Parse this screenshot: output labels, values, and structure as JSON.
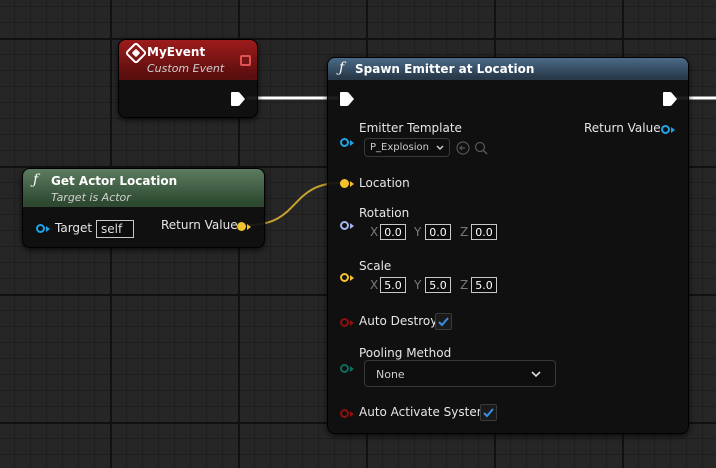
{
  "event_node": {
    "title": "MyEvent",
    "subtitle": "Custom Event"
  },
  "get_actor_location": {
    "title": "Get Actor Location",
    "subtitle": "Target is Actor",
    "target_label": "Target",
    "target_value": "self",
    "return_label": "Return Value"
  },
  "spawn_emitter": {
    "title": "Spawn Emitter at Location",
    "emitter_template_label": "Emitter Template",
    "emitter_template_value": "P_Explosion",
    "return_label": "Return Value",
    "location_label": "Location",
    "rotation": {
      "label": "Rotation",
      "x_label": "X",
      "y_label": "Y",
      "z_label": "Z",
      "x": "0.0",
      "y": "0.0",
      "z": "0.0"
    },
    "scale": {
      "label": "Scale",
      "x_label": "X",
      "y_label": "Y",
      "z_label": "Z",
      "x": "5.0",
      "y": "5.0",
      "z": "5.0"
    },
    "auto_destroy_label": "Auto Destroy",
    "auto_destroy_checked": true,
    "pooling_method_label": "Pooling Method",
    "pooling_method_value": "None",
    "auto_activate_label": "Auto Activate System",
    "auto_activate_checked": true
  },
  "colors": {
    "event_header": "#9e1c1c",
    "function_header": "#4b6a87",
    "pure_header": "#5c7b5f",
    "object_pin": "#1ea4e8",
    "vector_pin": "#f4c22c",
    "rotator_pin": "#a5b4ee",
    "bool_pin": "#8e1010",
    "enum_pin": "#0f6b5f",
    "wire_vector": "#c7a22b",
    "exec_wire": "#ffffff"
  },
  "icons": [
    "event-icon",
    "function-icon",
    "exec-pin",
    "checkmark-icon",
    "chevron-down-icon",
    "search-icon",
    "browse-arrow-icon"
  ]
}
